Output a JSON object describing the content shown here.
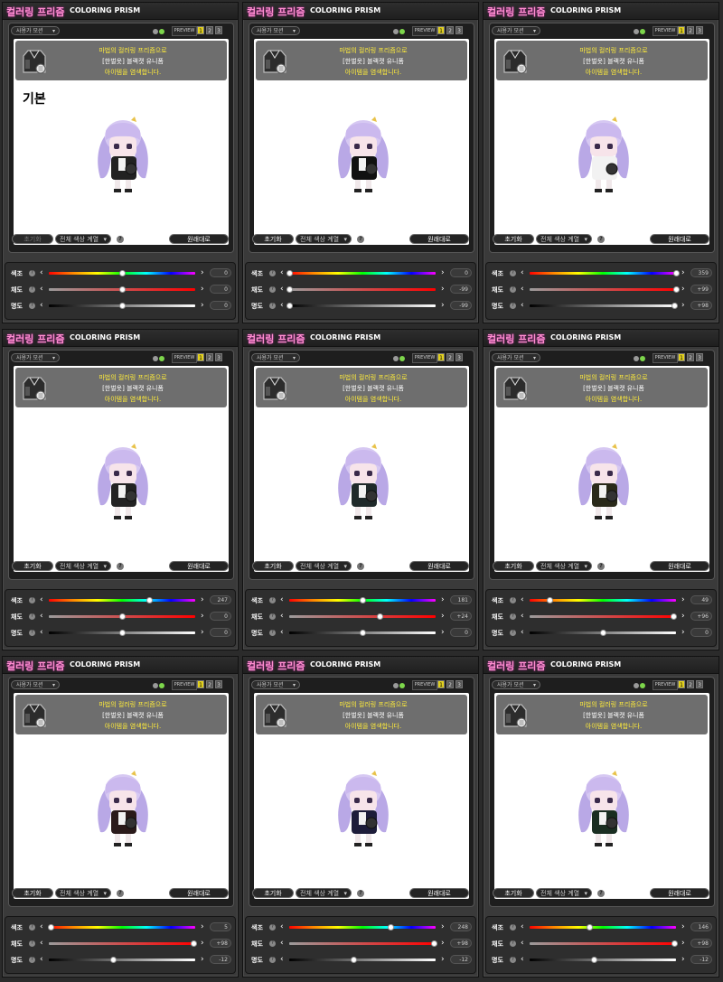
{
  "common": {
    "title_kor": "컬러링 프리즘",
    "title_eng": "COLORING PRISM",
    "select_label": "사용가 모션",
    "preview_label": "PREVIEW",
    "page_buttons": [
      "1",
      "2",
      "3"
    ],
    "msg_line1": "마법의 컬러링 프리즘으로",
    "msg_line2": "[한벌옷] 블랙캣 유니폼",
    "msg_line3": "아이템을 염색합니다.",
    "reset_label": "초기화",
    "all_colors_label": "전체 색상 계열",
    "help_glyph": "?",
    "original_label": "원래대로",
    "hue_label": "색조",
    "sat_label": "채도",
    "lum_label": "명도"
  },
  "panels": [
    {
      "basic_label": "기본",
      "reset_disabled": true,
      "hue": "0",
      "sat": "0",
      "lum": "0",
      "hue_frac": 0.5,
      "sat_frac": 0.5,
      "lum_frac": 0.5,
      "outfit": "#222222"
    },
    {
      "basic_label": "",
      "reset_disabled": false,
      "hue": "0",
      "sat": "-99",
      "lum": "-99",
      "hue_frac": 0.0,
      "sat_frac": 0.0,
      "lum_frac": 0.0,
      "outfit": "#111111"
    },
    {
      "basic_label": "",
      "reset_disabled": false,
      "hue": "359",
      "sat": "+99",
      "lum": "+98",
      "hue_frac": 1.0,
      "sat_frac": 1.0,
      "lum_frac": 0.99,
      "outfit": "#f2f2f2"
    },
    {
      "basic_label": "",
      "reset_disabled": false,
      "hue": "247",
      "sat": "0",
      "lum": "0",
      "hue_frac": 0.686,
      "sat_frac": 0.5,
      "lum_frac": 0.5,
      "outfit": "#232323"
    },
    {
      "basic_label": "",
      "reset_disabled": false,
      "hue": "181",
      "sat": "+24",
      "lum": "0",
      "hue_frac": 0.503,
      "sat_frac": 0.62,
      "lum_frac": 0.5,
      "outfit": "#1f2a2a"
    },
    {
      "basic_label": "",
      "reset_disabled": false,
      "hue": "49",
      "sat": "+96",
      "lum": "0",
      "hue_frac": 0.136,
      "sat_frac": 0.98,
      "lum_frac": 0.5,
      "outfit": "#2a2a1a"
    },
    {
      "basic_label": "",
      "reset_disabled": false,
      "hue": "5",
      "sat": "+98",
      "lum": "-12",
      "hue_frac": 0.014,
      "sat_frac": 0.99,
      "lum_frac": 0.44,
      "outfit": "#2a1a1a"
    },
    {
      "basic_label": "",
      "reset_disabled": false,
      "hue": "248",
      "sat": "+98",
      "lum": "-12",
      "hue_frac": 0.689,
      "sat_frac": 0.99,
      "lum_frac": 0.44,
      "outfit": "#1d1d3a"
    },
    {
      "basic_label": "",
      "reset_disabled": false,
      "hue": "146",
      "sat": "+98",
      "lum": "-12",
      "hue_frac": 0.406,
      "sat_frac": 0.99,
      "lum_frac": 0.44,
      "outfit": "#1a2e22"
    }
  ]
}
